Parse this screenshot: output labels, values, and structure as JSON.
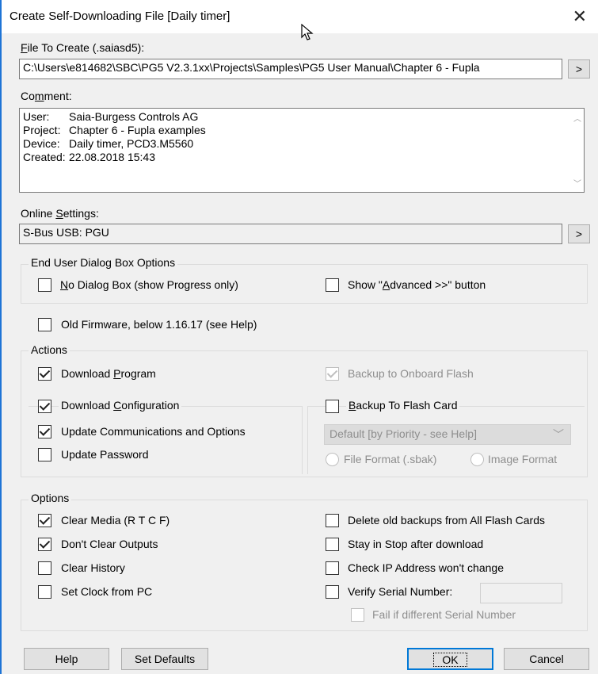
{
  "window": {
    "title": "Create Self-Downloading File [Daily timer]",
    "close_glyph": "✕"
  },
  "file_to_create": {
    "label_prefix": "F",
    "label_rest": "ile To Create (.saiasd5):",
    "value": "C:\\Users\\e814682\\SBC\\PG5 V2.3.1xx\\Projects\\Samples\\PG5 User Manual\\Chapter 6 - Fupla",
    "browse_label": ">"
  },
  "comment": {
    "label_prefix": "Co",
    "label_mn": "m",
    "label_rest": "ment:",
    "lines": [
      {
        "key": "User:",
        "value": "Saia-Burgess Controls AG"
      },
      {
        "key": "Project:",
        "value": "Chapter 6 - Fupla examples"
      },
      {
        "key": "Device:",
        "value": "Daily timer, PCD3.M5560"
      },
      {
        "key": "Created:",
        "value": "22.08.2018 15:43"
      }
    ]
  },
  "online_settings": {
    "label_prefix": "Online ",
    "label_s": "S",
    "label_rest": "ettings:",
    "value": "S-Bus USB: PGU",
    "browse_label": ">"
  },
  "end_user": {
    "title": "End User Dialog Box Options",
    "no_dialog": {
      "n": "N",
      "rest": "o Dialog Box (show Progress only)",
      "checked": false
    },
    "show_advanced": {
      "pre": "Show \"",
      "a": "A",
      "rest": "dvanced >>\" button",
      "checked": false
    }
  },
  "old_firmware": {
    "label": "Old Firmware, below 1.16.17 (see Help)",
    "checked": false
  },
  "actions": {
    "title": "Actions",
    "download_program": {
      "pre": "Download ",
      "u": "P",
      "rest": "rogram",
      "checked": true
    },
    "backup_onboard": {
      "label": "Backup to Onboard Flash",
      "checked": true,
      "disabled": true
    },
    "download_config": {
      "pre": "Download ",
      "u": "C",
      "rest": "onfiguration",
      "checked": true
    },
    "backup_flash_card": {
      "u": "B",
      "rest": "ackup To Flash Card",
      "checked": false
    },
    "update_comm": {
      "label": "Update Communications and Options",
      "checked": true
    },
    "update_password": {
      "label": "Update Password",
      "checked": false
    },
    "flash_card_select": "Default [by Priority - see Help]",
    "file_format": "File Format (.sbak)",
    "image_format": "Image Format"
  },
  "options": {
    "title": "Options",
    "clear_media": {
      "label": "Clear Media (R T C F)",
      "checked": true
    },
    "dont_clear_outputs": {
      "label": "Don't Clear Outputs",
      "checked": true
    },
    "clear_history": {
      "label": "Clear History",
      "checked": false
    },
    "set_clock": {
      "label": "Set Clock from PC",
      "checked": false
    },
    "delete_backups": {
      "label": "Delete old backups from All Flash Cards",
      "checked": false
    },
    "stay_in_stop": {
      "label": "Stay in Stop after download",
      "checked": false
    },
    "check_ip": {
      "label": "Check IP Address won't change",
      "checked": false
    },
    "verify_serial": {
      "label": "Verify Serial Number:",
      "checked": false
    },
    "fail_different": {
      "label": "Fail if different Serial Number",
      "checked": false
    }
  },
  "buttons": {
    "help": "Help",
    "set_defaults": "Set Defaults",
    "ok": "OK",
    "cancel": "Cancel"
  }
}
